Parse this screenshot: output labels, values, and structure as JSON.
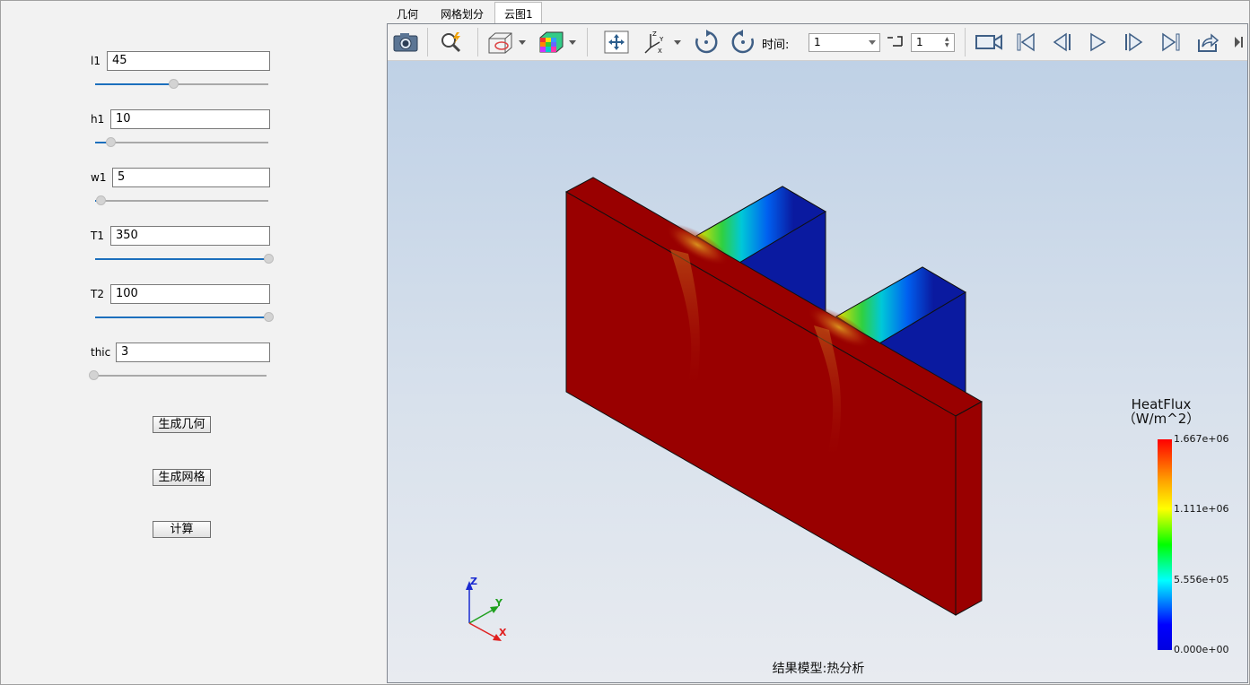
{
  "params": [
    {
      "label": "l1",
      "value": "45",
      "fraction": 0.45
    },
    {
      "label": "h1",
      "value": "10",
      "fraction": 0.09
    },
    {
      "label": "w1",
      "value": "5",
      "fraction": 0.03
    },
    {
      "label": "T1",
      "value": "350",
      "fraction": 1.0
    },
    {
      "label": "T2",
      "value": "100",
      "fraction": 1.0
    },
    {
      "label": "thic",
      "value": "3",
      "fraction": 0.0
    }
  ],
  "buttons": {
    "generate_geometry": "生成几何",
    "generate_mesh": "生成网格",
    "compute": "计算"
  },
  "tabs": [
    {
      "label": "几何",
      "active": false
    },
    {
      "label": "网格划分",
      "active": false
    },
    {
      "label": "云图1",
      "active": true
    }
  ],
  "toolbar": {
    "time_label": "时间:",
    "time_value": "1",
    "step_value": "1"
  },
  "legend": {
    "title": "HeatFlux",
    "unit": "（W/m^2）",
    "ticks": [
      "1.667e+06",
      "1.111e+06",
      "5.556e+05",
      "0.000e+00"
    ]
  },
  "axes": {
    "z": "Z",
    "y": "Y",
    "x": "X"
  },
  "status_caption": "结果模型:热分析",
  "colors": {
    "model_red": "#990000",
    "fin_blue": "#0a1aa0",
    "slider_blue": "#1c6fbd"
  }
}
